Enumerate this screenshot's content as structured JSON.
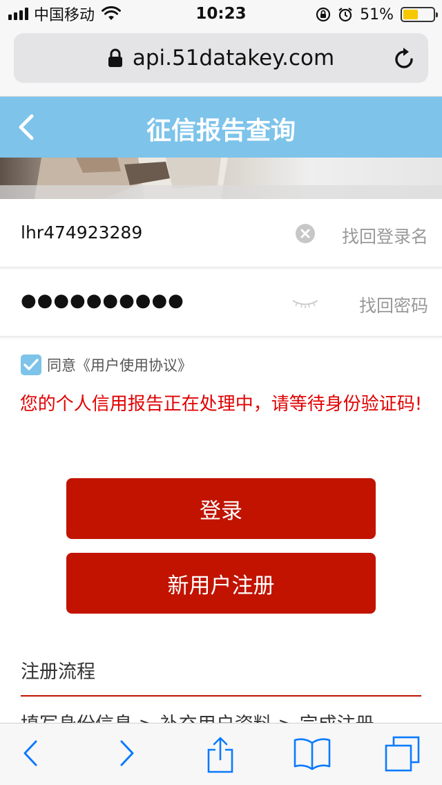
{
  "status_bar": {
    "carrier": "中国移动",
    "time": "10:23",
    "battery_percent": "51%",
    "battery_level": 0.51,
    "icons": [
      "signal-icon",
      "wifi-icon",
      "orientation-lock-icon",
      "alarm-icon",
      "battery-icon"
    ]
  },
  "browser": {
    "url": "api.51datakey.com",
    "icons": [
      "lock-icon",
      "reload-icon"
    ]
  },
  "header": {
    "title": "征信报告查询",
    "back_icon": "chevron-left-icon"
  },
  "form": {
    "username": {
      "value": "lhr474923289",
      "link": "找回登录名",
      "icon": "clear-icon"
    },
    "password": {
      "value": "●●●●●●●●●●",
      "link": "找回密码",
      "icon": "eye-closed-icon"
    },
    "agreement": {
      "text": "同意《用户使用协议》",
      "checked": true
    },
    "message": "您的个人信用报告正在处理中，请等待身份验证码!",
    "message_color": "#e00000"
  },
  "buttons": {
    "login": "登录",
    "register": "新用户注册"
  },
  "section": {
    "title": "注册流程",
    "flow": "填写身份信息 > 补充用户资料 > 完成注册"
  },
  "colors": {
    "header": "#7dc3ea",
    "button": "#c11300",
    "accent_line": "#c11300",
    "safari_blue": "#0a7aff"
  },
  "toolbar": {
    "icons": [
      "back-icon",
      "forward-icon",
      "share-icon",
      "bookmarks-icon",
      "tabs-icon"
    ]
  }
}
